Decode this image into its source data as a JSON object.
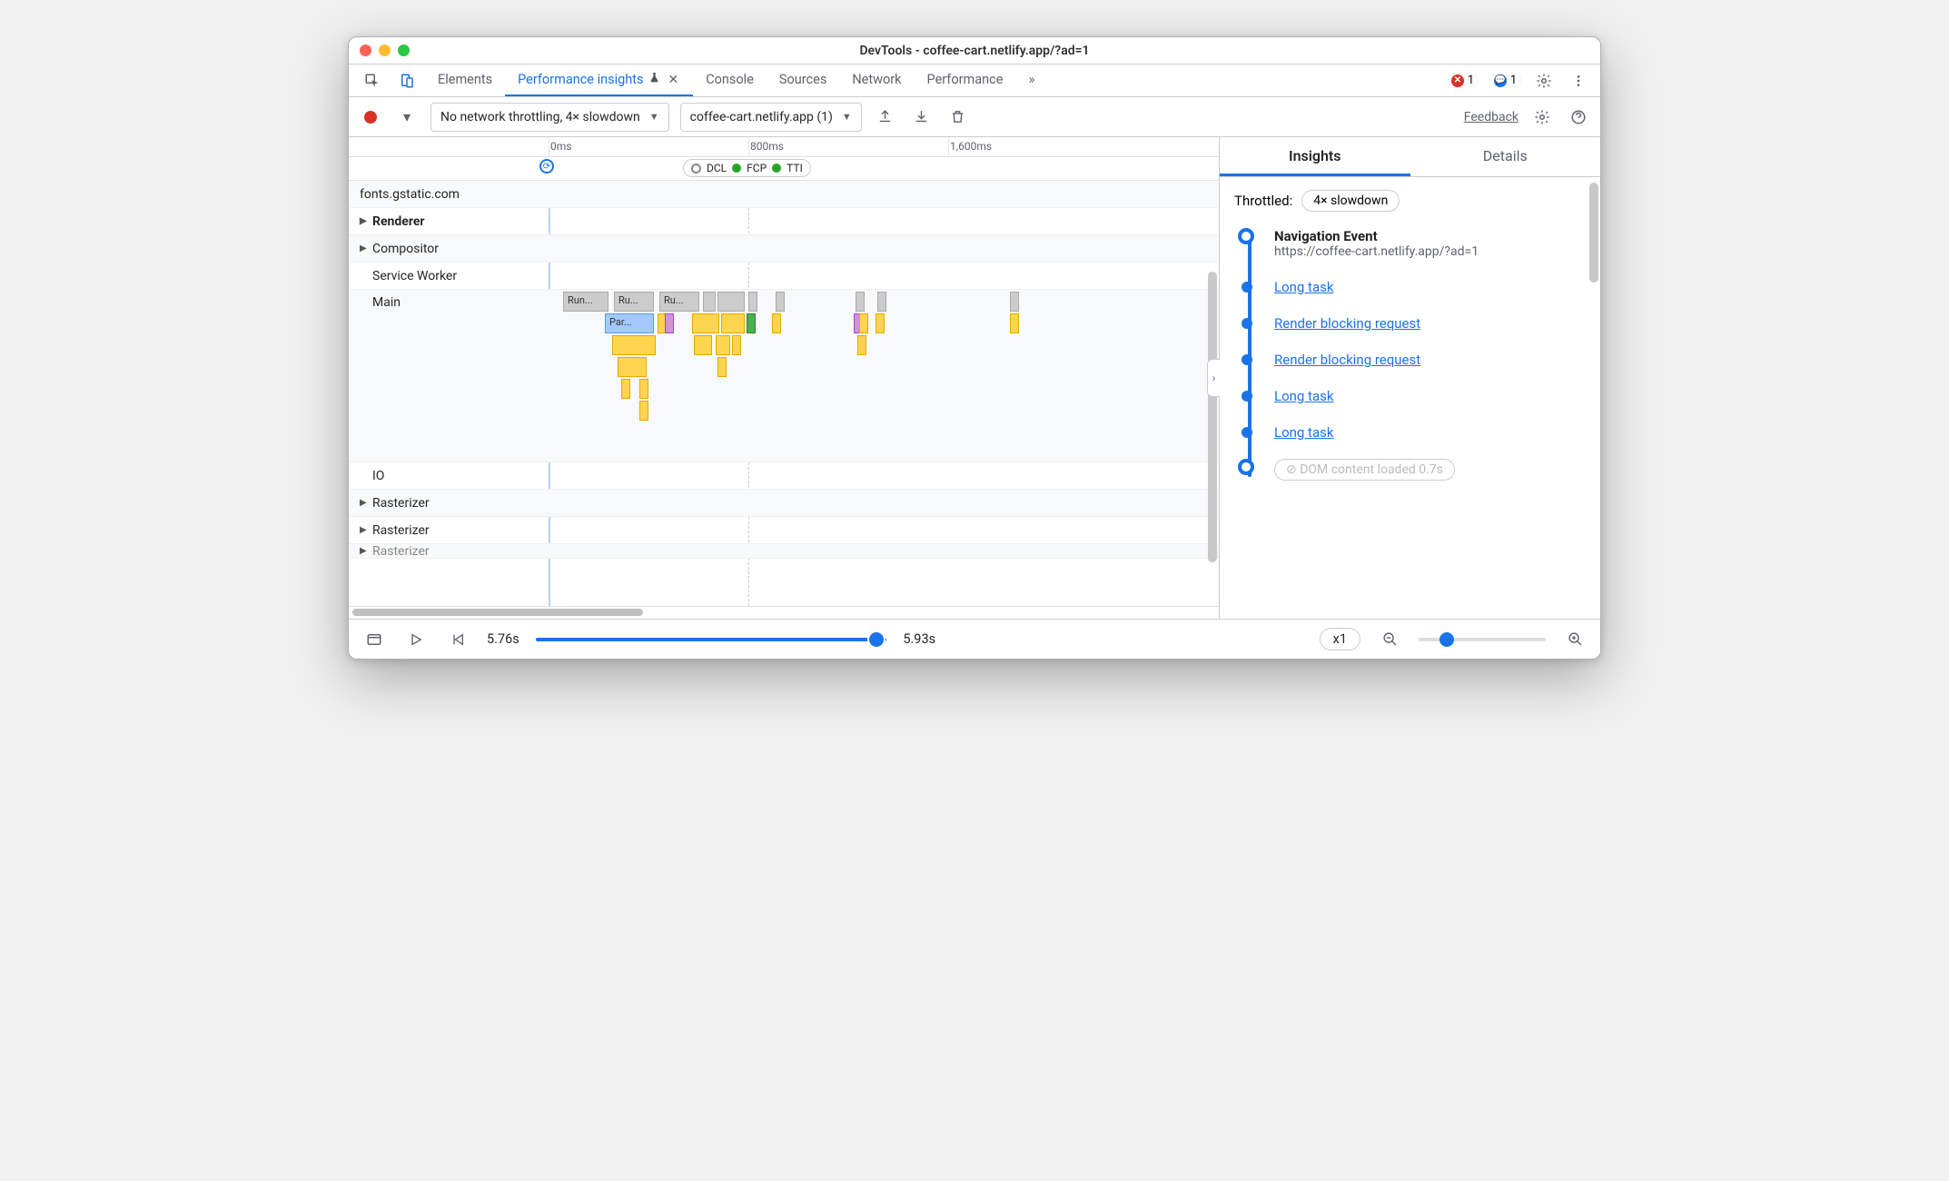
{
  "window": {
    "title": "DevTools - coffee-cart.netlify.app/?ad=1"
  },
  "tabs": {
    "items": [
      "Elements",
      "Performance insights",
      "Console",
      "Sources",
      "Network",
      "Performance"
    ],
    "active_index": 1,
    "overflow_glyph": "»",
    "errors_count": "1",
    "messages_count": "1"
  },
  "toolbar": {
    "throttling_label": "No network throttling, 4× slowdown",
    "page_selector": "coffee-cart.netlify.app (1)",
    "feedback": "Feedback"
  },
  "ruler": {
    "ticks": [
      "0ms",
      "800ms",
      "1,600ms"
    ]
  },
  "markers": {
    "dcl": "DCL",
    "fcp": "FCP",
    "tti": "TTI"
  },
  "tracks": {
    "rows": [
      "fonts.gstatic.com",
      "Renderer",
      "Compositor",
      "Service Worker",
      "Main",
      "IO",
      "Rasterizer",
      "Rasterizer",
      "Rasterizer"
    ],
    "main_blocks": {
      "run1": "Run...",
      "run2": "Ru...",
      "run3": "Ru...",
      "par": "Par..."
    }
  },
  "right": {
    "tabs": [
      "Insights",
      "Details"
    ],
    "active_index": 0,
    "throttled_label": "Throttled:",
    "throttled_value": "4× slowdown",
    "nav_event_title": "Navigation Event",
    "nav_event_url": "https://coffee-cart.netlify.app/?ad=1",
    "items": [
      "Long task",
      "Render blocking request",
      "Render blocking request",
      "Long task",
      "Long task"
    ],
    "cutoff": "DOM content loaded 0.7s"
  },
  "footer": {
    "left_time": "5.76s",
    "right_time": "5.93s",
    "zoom_label": "x1"
  }
}
